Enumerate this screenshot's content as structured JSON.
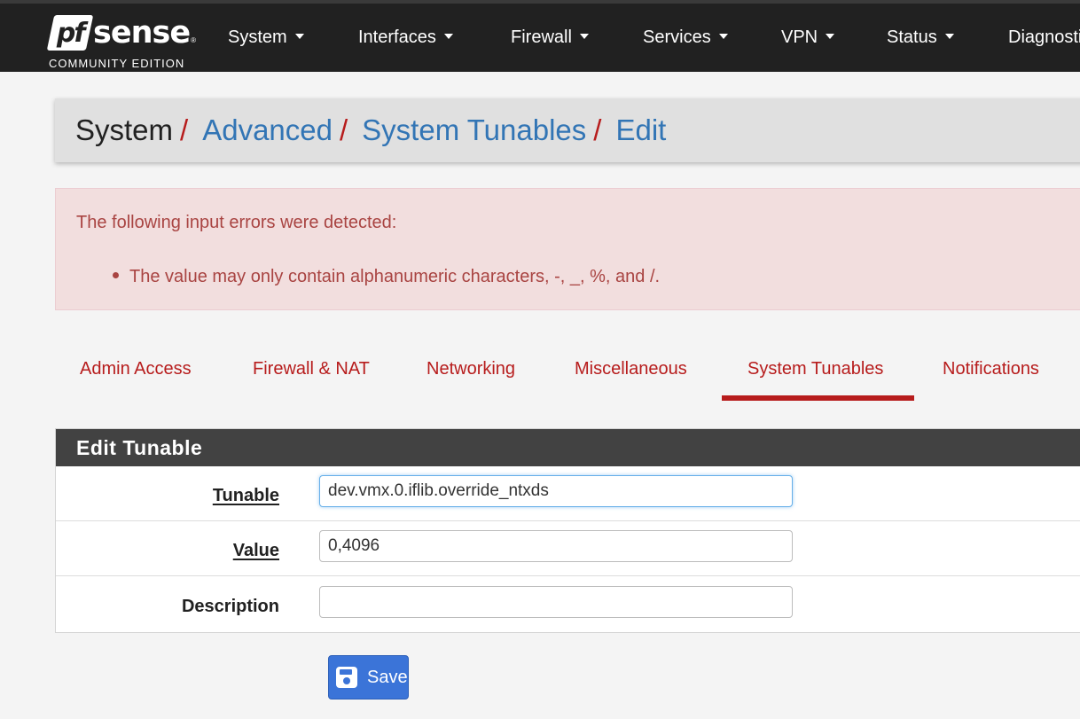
{
  "brand": {
    "logo_pf": "pf",
    "logo_sense": "sense",
    "logo_reg": "®",
    "edition": "COMMUNITY EDITION"
  },
  "nav": {
    "items": [
      {
        "label": "System"
      },
      {
        "label": "Interfaces"
      },
      {
        "label": "Firewall"
      },
      {
        "label": "Services"
      },
      {
        "label": "VPN"
      },
      {
        "label": "Status"
      },
      {
        "label": "Diagnostics"
      }
    ]
  },
  "breadcrumb": {
    "items": [
      "System",
      "Advanced",
      "System Tunables",
      "Edit"
    ],
    "separator": "/"
  },
  "alert": {
    "title": "The following input errors were detected:",
    "errors": [
      "The value may only contain alphanumeric characters, -, _, %, and /."
    ]
  },
  "tabs": {
    "items": [
      {
        "label": "Admin Access",
        "active": false
      },
      {
        "label": "Firewall & NAT",
        "active": false
      },
      {
        "label": "Networking",
        "active": false
      },
      {
        "label": "Miscellaneous",
        "active": false
      },
      {
        "label": "System Tunables",
        "active": true
      },
      {
        "label": "Notifications",
        "active": false
      }
    ]
  },
  "panel": {
    "title": "Edit Tunable",
    "fields": {
      "tunable": {
        "label": "Tunable",
        "value": "dev.vmx.0.iflib.override_ntxds"
      },
      "value": {
        "label": "Value",
        "value": "0,4096"
      },
      "description": {
        "label": "Description",
        "value": ""
      }
    }
  },
  "save": {
    "label": "Save",
    "icon": "floppy-disk-icon"
  },
  "colors": {
    "navbar": "#212121",
    "accent_red": "#b71c1c",
    "link_blue": "#3275b5",
    "alert_bg": "#f2dede",
    "alert_text": "#a94442",
    "panel_heading": "#424242",
    "save_button": "#3b74d8"
  }
}
